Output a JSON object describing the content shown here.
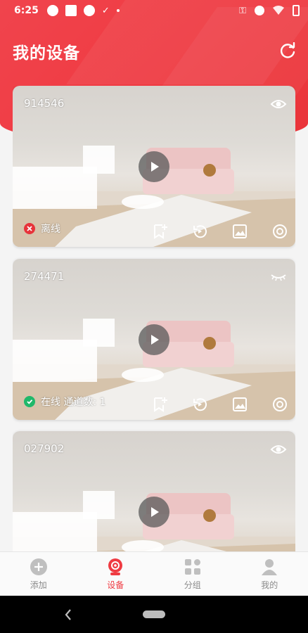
{
  "statusbar": {
    "time": "6:25"
  },
  "header": {
    "title": "我的设备"
  },
  "devices": [
    {
      "id": "914546",
      "status": "离线",
      "online": false,
      "visible": true
    },
    {
      "id": "274471",
      "status": "在线 通道数: 1",
      "online": true,
      "visible": false
    },
    {
      "id": "027902",
      "status": "",
      "online": true,
      "visible": true
    }
  ],
  "icons": {
    "refresh": "refresh-icon",
    "play": "play-icon",
    "eye": "eye-icon",
    "eye_closed": "eye-closed-icon",
    "bookmark": "bookmark-add-icon",
    "playback": "playback-icon",
    "image": "image-icon",
    "settings": "settings-icon"
  },
  "tabbar": {
    "items": [
      {
        "label": "添加",
        "icon": "add-icon"
      },
      {
        "label": "设备",
        "icon": "camera-icon",
        "active": true
      },
      {
        "label": "分组",
        "icon": "grid-icon"
      },
      {
        "label": "我的",
        "icon": "user-icon"
      }
    ]
  },
  "colors": {
    "accent": "#ef3b42",
    "online": "#1fb86a",
    "offline": "#e7333a"
  }
}
